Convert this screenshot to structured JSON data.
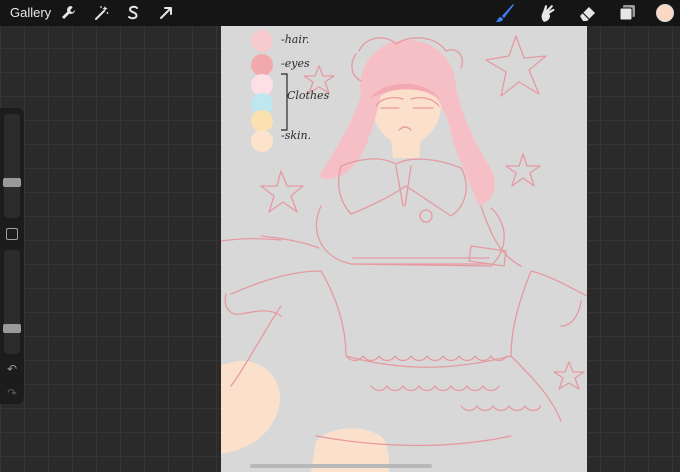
{
  "topbar": {
    "gallery_label": "Gallery",
    "left_tools": [
      {
        "name": "actions-wrench-icon"
      },
      {
        "name": "adjustments-wand-icon"
      },
      {
        "name": "selection-s-icon"
      },
      {
        "name": "transform-arrow-icon"
      }
    ],
    "right_tools": [
      {
        "name": "brush-icon",
        "active": true
      },
      {
        "name": "smudge-icon",
        "active": false
      },
      {
        "name": "eraser-icon",
        "active": false
      },
      {
        "name": "layers-icon",
        "active": false
      }
    ],
    "active_tool_color": "#3d7ff5",
    "current_color": "#fbd8c4"
  },
  "sidebar": {
    "brush_size_level": 0.33,
    "opacity_level": 0.22
  },
  "canvas": {
    "background": "#d8d8d8",
    "sketch_line_color": "#e59aa0",
    "palette": [
      {
        "label": "-hair.",
        "color": "#f6c9cd"
      },
      {
        "label": "-eyes",
        "color": "#f2a9ab"
      },
      {
        "label": "",
        "color": "#fde0e6"
      },
      {
        "label": "Clothes",
        "color": "#bfe7f0"
      },
      {
        "label": "",
        "color": "#fbe0b0"
      },
      {
        "label": "-skin.",
        "color": "#fde2cc"
      }
    ],
    "hair_color": "#f6bfc6",
    "skin_color": "#fbe1cc"
  }
}
